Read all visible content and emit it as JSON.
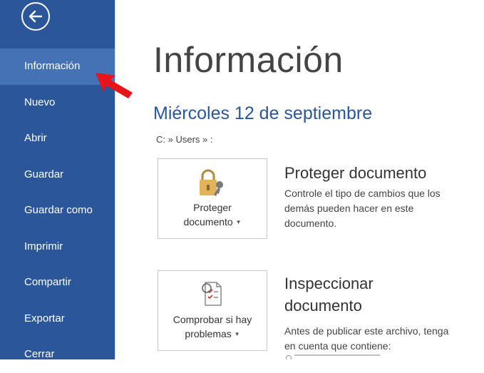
{
  "colors": {
    "sidebar": "#2b579a",
    "sidebar_active": "#4472b5",
    "accent": "#2b579a",
    "pointer_arrow": "#e8141b"
  },
  "sidebar": {
    "back_icon": "arrow-left-icon",
    "items": [
      {
        "label": "Información",
        "active": true
      },
      {
        "label": "Nuevo"
      },
      {
        "label": "Abrir"
      },
      {
        "label": "Guardar"
      },
      {
        "label": "Guardar como"
      },
      {
        "label": "Imprimir"
      },
      {
        "label": "Compartir"
      },
      {
        "label": "Exportar"
      },
      {
        "label": "Cerrar"
      }
    ]
  },
  "main": {
    "title": "Información",
    "doc_name": "Miércoles 12 de septiembre",
    "doc_path": "C: » Users » :",
    "sections": [
      {
        "button_line1": "Proteger",
        "button_line2": "documento",
        "icon": "lock-key-icon",
        "heading": "Proteger documento",
        "description": "Controle el tipo de cambios que los demás pueden hacer en este documento."
      },
      {
        "button_line1": "Comprobar si hay",
        "button_line2": "problemas",
        "icon": "inspect-checklist-icon",
        "heading_line1": "Inspeccionar",
        "heading_line2": "documento",
        "description": "Antes de publicar este archivo, tenga en cuenta que contiene:"
      }
    ]
  }
}
